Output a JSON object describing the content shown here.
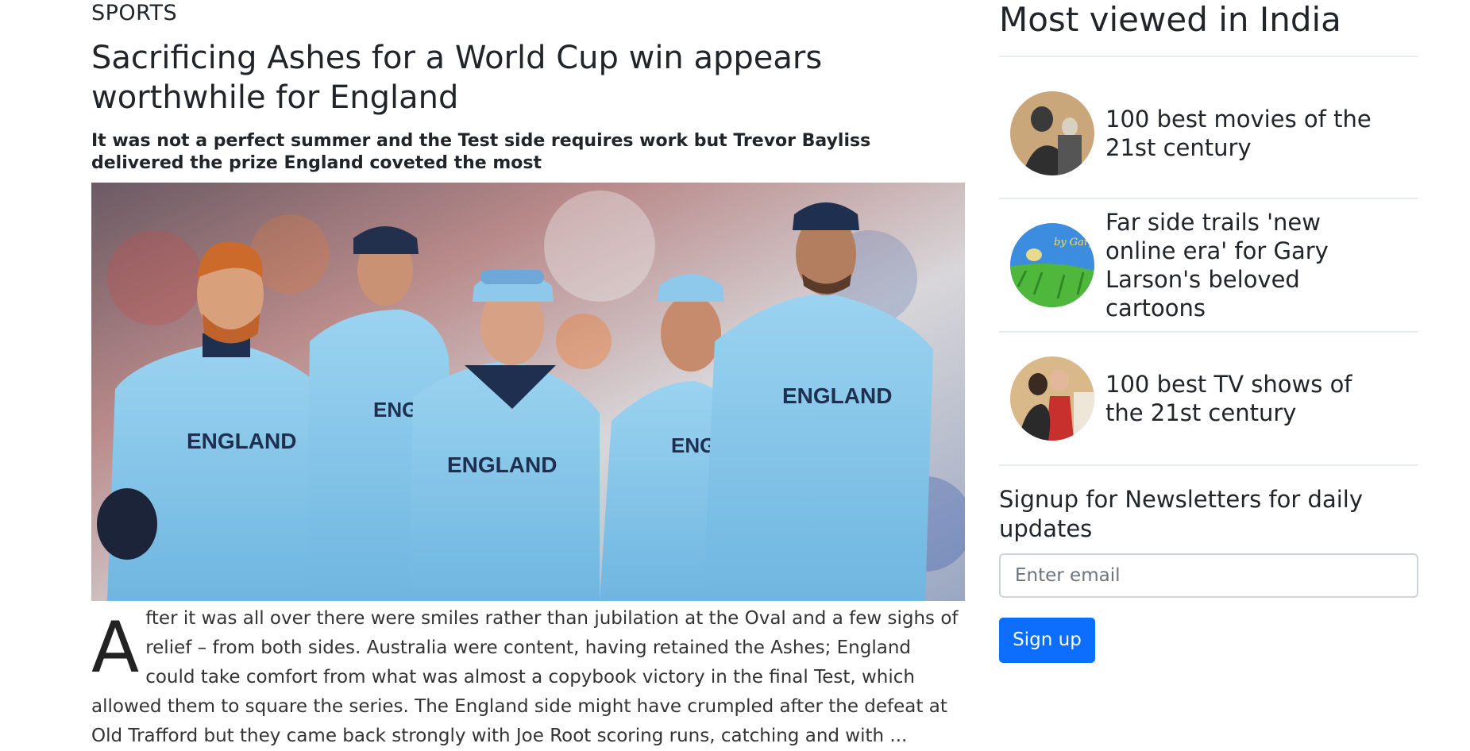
{
  "article": {
    "category": "SPORTS",
    "headline": "Sacrificing Ashes for a World Cup win appears worthwhile for England",
    "standfirst": "It was not a perfect summer and the Test side requires work but Trevor Bayliss delivered the prize England coveted the most",
    "hero_image_alt": "England cricket players",
    "dropcap": "A",
    "body": "fter it was all over there were smiles rather than jubilation at the Oval and a few sighs of relief – from both sides. Australia were content, having retained the Ashes; England could take comfort from what was almost a copybook victory in the final Test, which allowed them to square the series. The England side might have crumpled after the defeat at Old Trafford but they came back strongly with Joe Root scoring runs, catching and with ..."
  },
  "sidebar": {
    "title": "Most viewed in India",
    "items": [
      {
        "title": "100 best movies of the 21st century"
      },
      {
        "title": "Far side trails 'new online era' for Gary Larson's beloved cartoons"
      },
      {
        "title": "100 best TV shows of the 21st century"
      }
    ],
    "newsletter": {
      "title": "Signup for Newsletters for daily updates",
      "email_placeholder": "Enter email",
      "button_label": "Sign up"
    }
  },
  "colors": {
    "accent": "#0d6efd",
    "jersey": "#8ec8ea",
    "text": "#212529"
  }
}
